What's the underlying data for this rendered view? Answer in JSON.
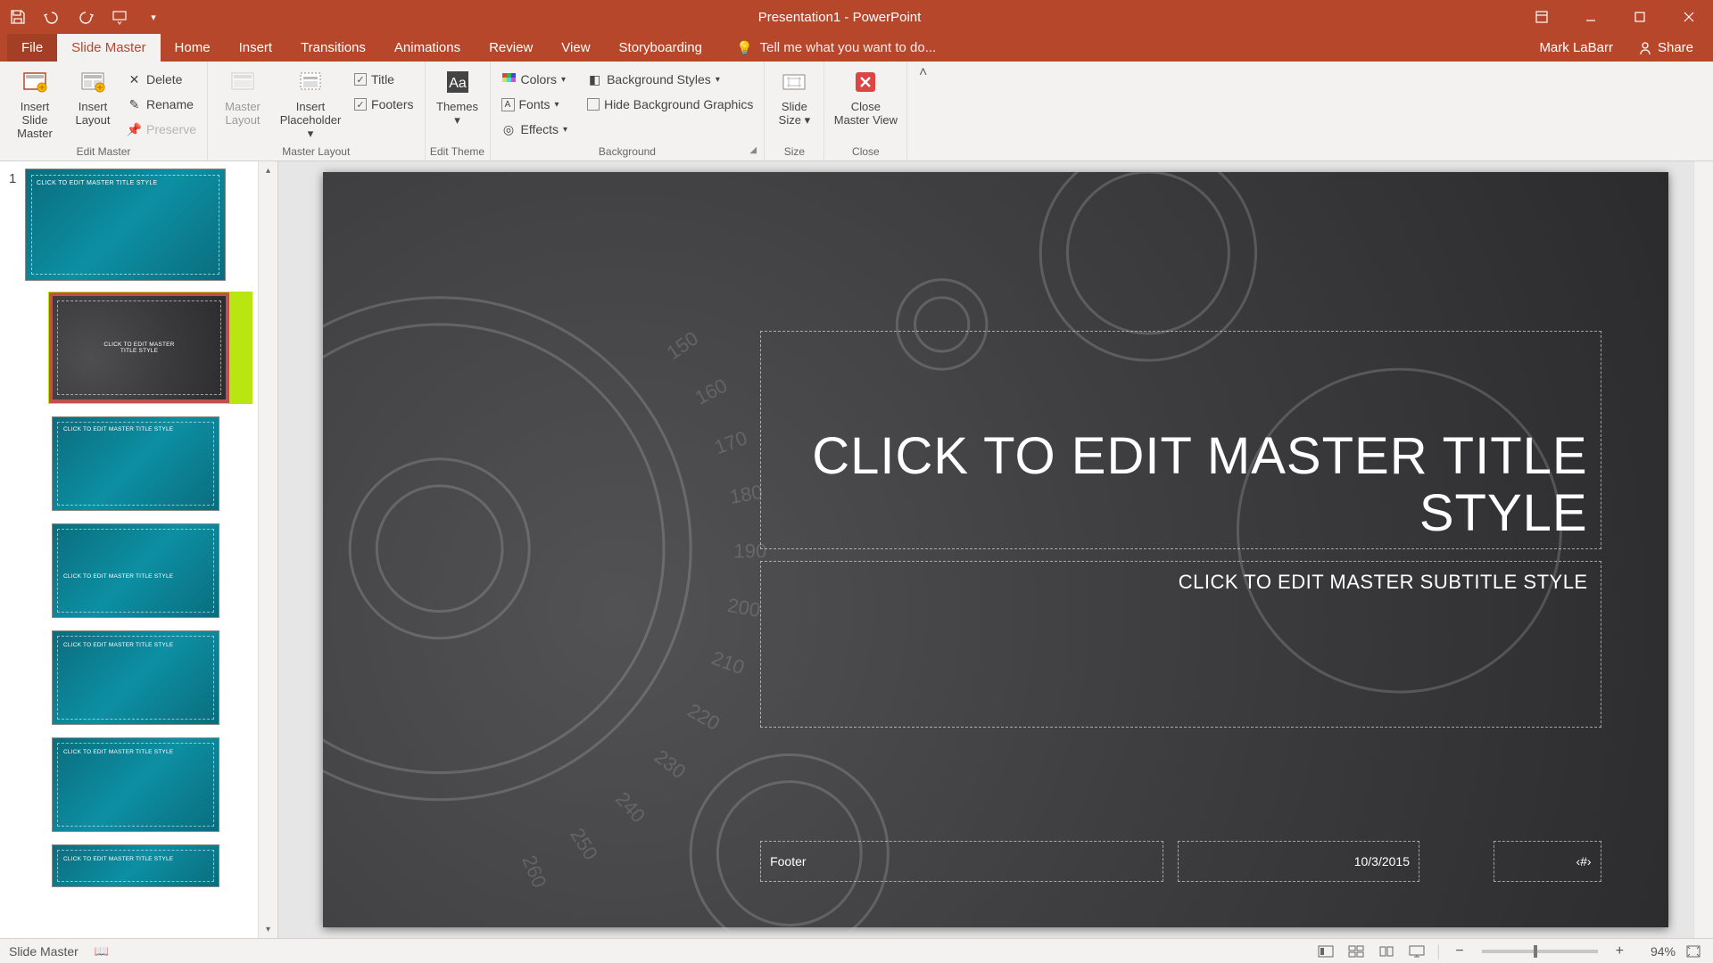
{
  "app": {
    "title": "Presentation1 - PowerPoint"
  },
  "user": {
    "name": "Mark LaBarr",
    "share": "Share"
  },
  "qat": {
    "save": "save-icon"
  },
  "tabs": {
    "file": "File",
    "slidemaster": "Slide Master",
    "home": "Home",
    "insert": "Insert",
    "transitions": "Transitions",
    "animations": "Animations",
    "review": "Review",
    "view": "View",
    "storyboarding": "Storyboarding"
  },
  "tellme": {
    "placeholder": "Tell me what you want to do..."
  },
  "ribbon": {
    "editmaster": {
      "label": "Edit Master",
      "insert_slide_master": "Insert Slide\nMaster",
      "insert_layout": "Insert\nLayout",
      "delete": "Delete",
      "rename": "Rename",
      "preserve": "Preserve"
    },
    "masterlayout": {
      "label": "Master Layout",
      "master_layout": "Master\nLayout",
      "insert_placeholder": "Insert\nPlaceholder",
      "title": "Title",
      "footers": "Footers"
    },
    "edittheme": {
      "label": "Edit Theme",
      "themes": "Themes"
    },
    "background": {
      "label": "Background",
      "colors": "Colors",
      "fonts": "Fonts",
      "effects": "Effects",
      "bg_styles": "Background Styles",
      "hide_bg": "Hide Background Graphics"
    },
    "size": {
      "label": "Size",
      "slide_size": "Slide\nSize"
    },
    "close": {
      "label": "Close",
      "close_mv": "Close\nMaster View"
    }
  },
  "slide": {
    "title": "CLICK TO EDIT MASTER TITLE STYLE",
    "subtitle": "CLICK TO EDIT MASTER SUBTITLE STYLE",
    "footer": "Footer",
    "date": "10/3/2015",
    "number": "‹#›"
  },
  "thumbs": {
    "master_num": "1",
    "master_label": "CLICK TO EDIT MASTER TITLE STYLE",
    "layout_selected": "CLICK TO EDIT MASTER\nTITLE STYLE",
    "layout2": "CLICK TO EDIT MASTER TITLE STYLE",
    "layout3": "CLICK TO EDIT MASTER TITLE STYLE",
    "layout4": "CLICK TO EDIT MASTER TITLE STYLE",
    "layout5": "CLICK TO EDIT MASTER TITLE STYLE",
    "layout6": "CLICK TO EDIT MASTER TITLE STYLE"
  },
  "status": {
    "mode": "Slide Master",
    "zoom": "94%"
  }
}
